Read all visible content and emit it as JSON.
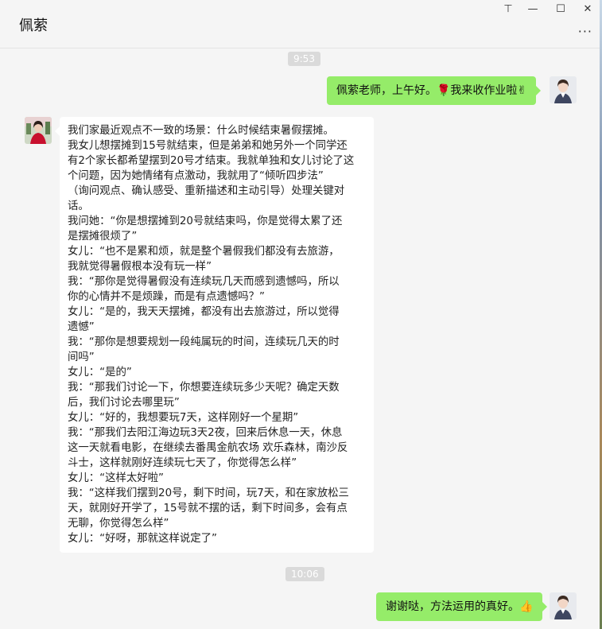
{
  "header": {
    "title": "佩萦",
    "controls": {
      "pin": "⊤",
      "minimize": "—",
      "maximize": "☐",
      "close": "✕"
    },
    "more": "···"
  },
  "messages": {
    "time1": "9:53",
    "me1_text": "佩萦老师，上午好。🌹我来收作业啦✌",
    "other_lines": [
      "我们家最近观点不一致的场景：什么时候结束暑假摆摊。",
      "我女儿想摆摊到15号就结束，但是弟弟和她另外一个同学还",
      "有2个家长都希望摆到20号才结束。我就单独和女儿讨论了这",
      "个问题，因为她情绪有点激动，我就用了“倾听四步法”",
      "（询问观点、确认感受、重新描述和主动引导）处理关键对",
      "话。",
      "我问她：“你是想摆摊到20号就结束吗，你是觉得太累了还",
      "是摆摊很烦了”",
      "女儿：“也不是累和烦，就是整个暑假我们都没有去旅游，",
      "我就觉得暑假根本没有玩一样”",
      "我：“那你是觉得暑假没有连续玩几天而感到遗憾吗，所以",
      "你的心情并不是烦躁，而是有点遗憾吗？”",
      "女儿：“是的，我天天摆摊，都没有出去旅游过，所以觉得",
      "遗憾”",
      "我：“那你是想要规划一段纯属玩的时间，连续玩几天的时",
      "间吗”",
      "女儿：“是的”",
      "我：“那我们讨论一下，你想要连续玩多少天呢？确定天数",
      "后，我们讨论去哪里玩”",
      "女儿：“好的，我想要玩7天，这样刚好一个星期”",
      "我：“那我们去阳江海边玩3天2夜，回来后休息一天，休息",
      "这一天就看电影，在继续去番禺金航农场 欢乐森林，南沙反",
      "斗士，这样就刚好连续玩七天了，你觉得怎么样”",
      "女儿：“这样太好啦”",
      "我：“这样我们摆到20号，剩下时间，玩7天，和在家放松三",
      "天，就刚好开学了，15号就不摆的话，剩下时间多，会有点",
      "无聊，你觉得怎么样”",
      "女儿：“好呀，那就这样说定了”"
    ],
    "time2": "10:06",
    "me2_text": "谢谢哒，方法运用的真好。👍"
  }
}
